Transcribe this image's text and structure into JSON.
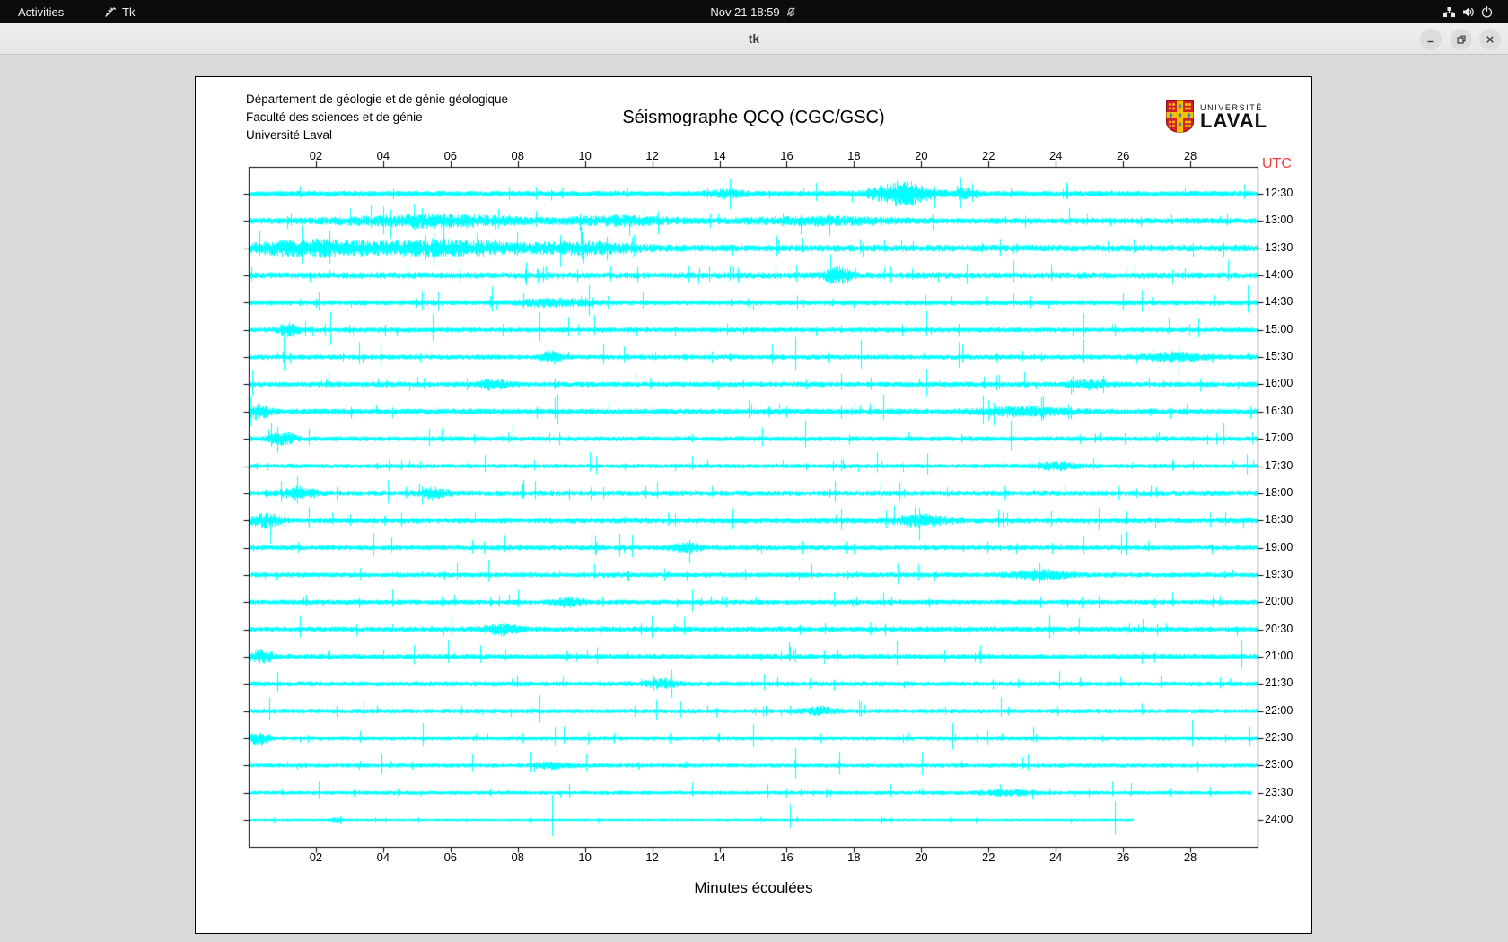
{
  "topbar": {
    "activities": "Activities",
    "app_name": "Tk",
    "clock": "Nov 21  18:59",
    "icons": [
      "tk-icon",
      "bell-muted-icon",
      "network-icon",
      "volume-icon",
      "power-icon"
    ]
  },
  "titlebar": {
    "title": "tk",
    "buttons": [
      "minimize",
      "maximize",
      "close"
    ]
  },
  "canvas": {
    "header_lines": {
      "line1": "Département de géologie et de génie géologique",
      "line2": "Faculté des sciences et de génie",
      "line3": "Université Laval"
    },
    "title": "Séismographe QCQ (CGC/GSC)",
    "logo": {
      "small": "UNIVERSITÉ",
      "big": "LAVAL"
    }
  },
  "chart_data": {
    "type": "line",
    "subtype": "seismogram-helicorder",
    "title": "Séismographe QCQ (CGC/GSC)",
    "xlabel": "Minutes écoulées",
    "right_axis_title": "UTC",
    "right_axis_title_color": "#f63b3b",
    "trace_color": "#00ffff",
    "x_range_minutes": [
      0,
      30
    ],
    "x_tick_labels": [
      "02",
      "04",
      "06",
      "08",
      "10",
      "12",
      "14",
      "16",
      "18",
      "20",
      "22",
      "24",
      "26",
      "28"
    ],
    "x_tick_minutes": [
      2,
      4,
      6,
      8,
      10,
      12,
      14,
      16,
      18,
      20,
      22,
      24,
      26,
      28
    ],
    "grid": false,
    "rows": [
      {
        "utc": "12:30",
        "seed": 9001,
        "noise": 1.3,
        "nspikes": 10,
        "spike_amp": 14,
        "bursts": [
          [
            19.4,
            0.8,
            4.5
          ],
          [
            14.2,
            0.5,
            1.2
          ],
          [
            21.3,
            0.4,
            1.5
          ]
        ],
        "end": 30
      },
      {
        "utc": "13:00",
        "seed": 9002,
        "noise": 1.4,
        "nspikes": 12,
        "spike_amp": 16,
        "bursts": [
          [
            5.5,
            2.5,
            1.8
          ],
          [
            11,
            1.5,
            1.2
          ],
          [
            17,
            2,
            1.0
          ]
        ],
        "end": 30
      },
      {
        "utc": "13:30",
        "seed": 9003,
        "noise": 1.6,
        "nspikes": 14,
        "spike_amp": 15,
        "bursts": [
          [
            2,
            2,
            2.2
          ],
          [
            6,
            2,
            2.0
          ],
          [
            10,
            1.5,
            1.5
          ]
        ],
        "end": 30
      },
      {
        "utc": "14:00",
        "seed": 9004,
        "noise": 1.5,
        "nspikes": 16,
        "spike_amp": 18,
        "bursts": [
          [
            17.5,
            0.4,
            2.5
          ]
        ],
        "end": 30
      },
      {
        "utc": "14:30",
        "seed": 9005,
        "noise": 1.2,
        "nspikes": 14,
        "spike_amp": 20,
        "bursts": [
          [
            9,
            1,
            1.2
          ]
        ],
        "end": 30
      },
      {
        "utc": "15:00",
        "seed": 9006,
        "noise": 1.1,
        "nspikes": 12,
        "spike_amp": 22,
        "bursts": [
          [
            1.2,
            0.3,
            3.0
          ]
        ],
        "end": 30
      },
      {
        "utc": "15:30",
        "seed": 9007,
        "noise": 1.1,
        "nspikes": 12,
        "spike_amp": 25,
        "bursts": [
          [
            9,
            0.3,
            2.5
          ],
          [
            27.5,
            0.8,
            1.8
          ]
        ],
        "end": 30
      },
      {
        "utc": "16:00",
        "seed": 9008,
        "noise": 1.2,
        "nspikes": 12,
        "spike_amp": 18,
        "bursts": [
          [
            7.3,
            0.4,
            2.0
          ],
          [
            25,
            0.5,
            1.6
          ]
        ],
        "end": 30
      },
      {
        "utc": "16:30",
        "seed": 9009,
        "noise": 1.3,
        "nspikes": 10,
        "spike_amp": 20,
        "bursts": [
          [
            0.3,
            0.3,
            3.0
          ],
          [
            23,
            1.2,
            1.4
          ]
        ],
        "end": 30
      },
      {
        "utc": "17:00",
        "seed": 9010,
        "noise": 1.1,
        "nspikes": 10,
        "spike_amp": 22,
        "bursts": [
          [
            1,
            0.4,
            2.5
          ]
        ],
        "end": 30
      },
      {
        "utc": "17:30",
        "seed": 9011,
        "noise": 1.0,
        "nspikes": 12,
        "spike_amp": 16,
        "bursts": [
          [
            24,
            0.6,
            1.6
          ]
        ],
        "end": 30
      },
      {
        "utc": "18:00",
        "seed": 9012,
        "noise": 1.3,
        "nspikes": 12,
        "spike_amp": 16,
        "bursts": [
          [
            1.5,
            0.5,
            2.0
          ],
          [
            5.5,
            0.4,
            1.8
          ]
        ],
        "end": 30
      },
      {
        "utc": "18:30",
        "seed": 9013,
        "noise": 1.4,
        "nspikes": 12,
        "spike_amp": 18,
        "bursts": [
          [
            0.5,
            0.4,
            2.2
          ],
          [
            20,
            0.8,
            1.5
          ]
        ],
        "end": 30
      },
      {
        "utc": "19:00",
        "seed": 9014,
        "noise": 1.1,
        "nspikes": 12,
        "spike_amp": 20,
        "bursts": [
          [
            13,
            0.4,
            2.0
          ]
        ],
        "end": 30
      },
      {
        "utc": "19:30",
        "seed": 9015,
        "noise": 1.1,
        "nspikes": 10,
        "spike_amp": 18,
        "bursts": [
          [
            23.5,
            0.8,
            2.0
          ]
        ],
        "end": 30
      },
      {
        "utc": "20:00",
        "seed": 9016,
        "noise": 1.1,
        "nspikes": 14,
        "spike_amp": 16,
        "bursts": [
          [
            9.5,
            0.4,
            1.8
          ]
        ],
        "end": 30
      },
      {
        "utc": "20:30",
        "seed": 9017,
        "noise": 1.2,
        "nspikes": 12,
        "spike_amp": 18,
        "bursts": [
          [
            7.5,
            0.5,
            2.0
          ]
        ],
        "end": 30
      },
      {
        "utc": "21:00",
        "seed": 9018,
        "noise": 1.2,
        "nspikes": 10,
        "spike_amp": 20,
        "bursts": [
          [
            0.4,
            0.3,
            2.5
          ]
        ],
        "end": 30
      },
      {
        "utc": "21:30",
        "seed": 9019,
        "noise": 1.1,
        "nspikes": 10,
        "spike_amp": 16,
        "bursts": [
          [
            12.3,
            0.4,
            2.0
          ]
        ],
        "end": 30
      },
      {
        "utc": "22:00",
        "seed": 9020,
        "noise": 1.0,
        "nspikes": 10,
        "spike_amp": 18,
        "bursts": [
          [
            17,
            0.5,
            1.6
          ]
        ],
        "end": 30
      },
      {
        "utc": "22:30",
        "seed": 9021,
        "noise": 1.0,
        "nspikes": 10,
        "spike_amp": 22,
        "bursts": [
          [
            0.3,
            0.3,
            2.8
          ]
        ],
        "end": 30
      },
      {
        "utc": "23:00",
        "seed": 9022,
        "noise": 0.9,
        "nspikes": 9,
        "spike_amp": 20,
        "bursts": [
          [
            9,
            0.5,
            1.6
          ]
        ],
        "end": 30
      },
      {
        "utc": "23:30",
        "seed": 9023,
        "noise": 0.8,
        "nspikes": 8,
        "spike_amp": 18,
        "bursts": [
          [
            22.5,
            0.8,
            1.6
          ]
        ],
        "end": 29.8
      },
      {
        "utc": "24:00",
        "seed": 9024,
        "noise": 0.45,
        "nspikes": 3,
        "spike_amp": 30,
        "bursts": [
          [
            2.6,
            0.15,
            2.0
          ]
        ],
        "end": 26.3
      }
    ]
  }
}
